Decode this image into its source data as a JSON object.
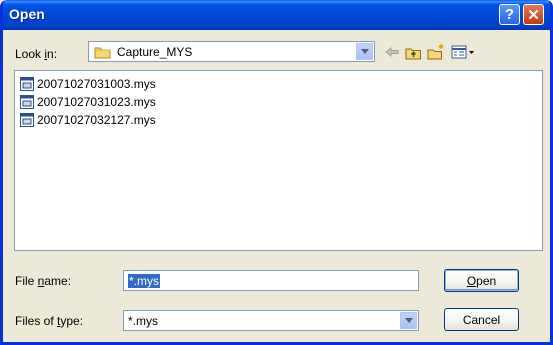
{
  "window": {
    "title": "Open",
    "help_glyph": "?",
    "close_glyph": "✕"
  },
  "lookin": {
    "label_pre": "Look ",
    "label_key": "i",
    "label_post": "n:",
    "value": "Capture_MYS",
    "folder_icon": "folder-icon"
  },
  "toolbar": {
    "back_icon": "back-arrow-icon",
    "up_icon": "up-one-level-icon",
    "new_folder_icon": "new-folder-icon",
    "views_icon": "views-menu-icon"
  },
  "files": [
    {
      "name": "20071027031003.mys",
      "icon": "mys-file-icon"
    },
    {
      "name": "20071027031023.mys",
      "icon": "mys-file-icon"
    },
    {
      "name": "20071027032127.mys",
      "icon": "mys-file-icon"
    }
  ],
  "filename": {
    "label_pre": "File ",
    "label_key": "n",
    "label_post": "ame:",
    "value": "*.mys"
  },
  "filetype": {
    "label_pre": "Files of ",
    "label_key": "t",
    "label_post": "ype:",
    "value": "*.mys"
  },
  "buttons": {
    "open_key": "O",
    "open_rest": "pen",
    "cancel": "Cancel"
  },
  "colors": {
    "title_bar": "#0054e3",
    "dialog_bg": "#ece9d8",
    "selection": "#316ac5",
    "border": "#7f9db9"
  }
}
